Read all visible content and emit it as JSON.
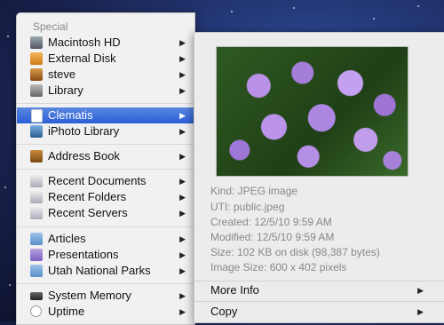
{
  "sidebar": {
    "header": "Special",
    "items": [
      {
        "label": "Macintosh HD",
        "icon": "hard-drive-icon"
      },
      {
        "label": "External Disk",
        "icon": "external-disk-icon"
      },
      {
        "label": "steve",
        "icon": "home-icon"
      },
      {
        "label": "Library",
        "icon": "library-icon"
      },
      {
        "label": "Clematis",
        "icon": "jpeg-file-icon"
      },
      {
        "label": "iPhoto Library",
        "icon": "iphoto-icon"
      },
      {
        "label": "Address Book",
        "icon": "address-book-icon"
      },
      {
        "label": "Recent Documents",
        "icon": "recent-documents-icon"
      },
      {
        "label": "Recent Folders",
        "icon": "recent-folders-icon"
      },
      {
        "label": "Recent Servers",
        "icon": "recent-servers-icon"
      },
      {
        "label": "Articles",
        "icon": "folder-icon"
      },
      {
        "label": "Presentations",
        "icon": "folder-icon"
      },
      {
        "label": "Utah National Parks",
        "icon": "folder-icon"
      },
      {
        "label": "System Memory",
        "icon": "memory-icon"
      },
      {
        "label": "Uptime",
        "icon": "clock-icon"
      }
    ],
    "selected": "Clematis"
  },
  "preview": {
    "kind": "Kind: JPEG image",
    "uti": "UTI: public.jpeg",
    "created": "Created: 12/5/10 9:59 AM",
    "modified": "Modified: 12/5/10 9:59 AM",
    "size": "Size: 102 KB on disk (98,387 bytes)",
    "image_size": "Image Size: 600 x 402 pixels",
    "thumbnail_icon": "clematis-photo"
  },
  "actions": [
    {
      "label": "More Info"
    },
    {
      "label": "Copy"
    }
  ],
  "colors": {
    "selection": "#2a5fd6",
    "menu_bg": "#f1f1f1",
    "panel_bg": "#ececec",
    "muted_text": "#888888"
  }
}
